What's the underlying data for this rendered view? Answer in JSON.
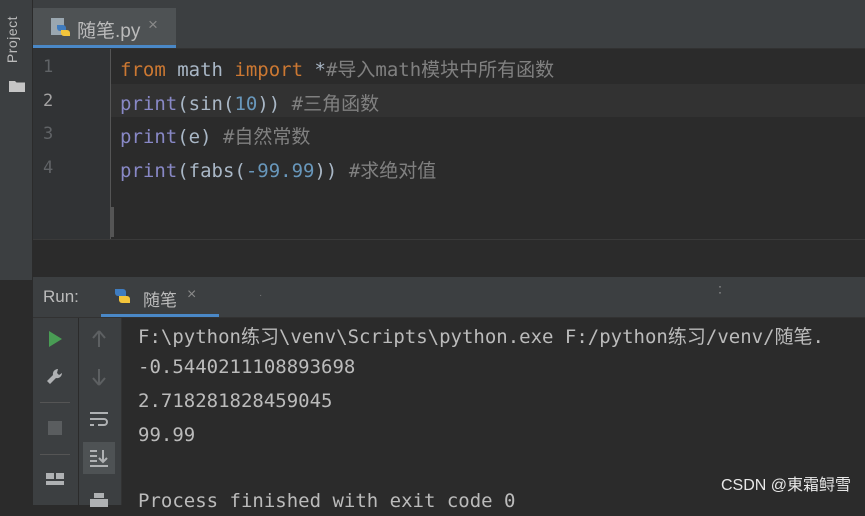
{
  "sidebar": {
    "project_label": "Project",
    "folder_icon": "folder-icon"
  },
  "editor_tab": {
    "label": "随笔.py",
    "close": "×",
    "icon": "python-file-icon"
  },
  "editor": {
    "line_numbers": [
      "1",
      "2",
      "3",
      "4"
    ],
    "current_line": 2,
    "lines": [
      {
        "kw1": "from",
        "mid1": " math ",
        "kw2": "import",
        "rest": " *",
        "comment": "#导入math模块中所有函数"
      },
      {
        "fn": "print",
        "a": "(",
        "fn2": "sin",
        "b": "(",
        "num": "10",
        "c": ")) ",
        "comment": "#三角函数"
      },
      {
        "fn": "print",
        "a": "(e) ",
        "comment": "#自然常数"
      },
      {
        "fn": "print",
        "a": "(fabs(",
        "num": "-99.99",
        "c": ")) ",
        "comment": "#求绝对值"
      }
    ]
  },
  "run_window": {
    "title": "Run:",
    "tab_label": "随笔",
    "tab_close": "×",
    "output": [
      "F:\\python练习\\venv\\Scripts\\python.exe F:/python练习/venv/随笔.",
      "-0.5440211108893698",
      "2.718281828459045",
      "99.99",
      "",
      "Process finished with exit code 0"
    ],
    "toolbar_left": [
      "run-icon",
      "wrench-icon",
      "stop-icon",
      "layout-icon"
    ],
    "toolbar_right": [
      "arrow-up-icon",
      "arrow-down-icon",
      "soft-wrap-icon",
      "scroll-to-end-icon",
      "print-icon"
    ]
  },
  "watermark": "CSDN @東霜鲟雪",
  "colors": {
    "keyword": "#cc7832",
    "builtin": "#8888c6",
    "number": "#6897bb",
    "comment": "#808080",
    "accent": "#4a88c7"
  }
}
